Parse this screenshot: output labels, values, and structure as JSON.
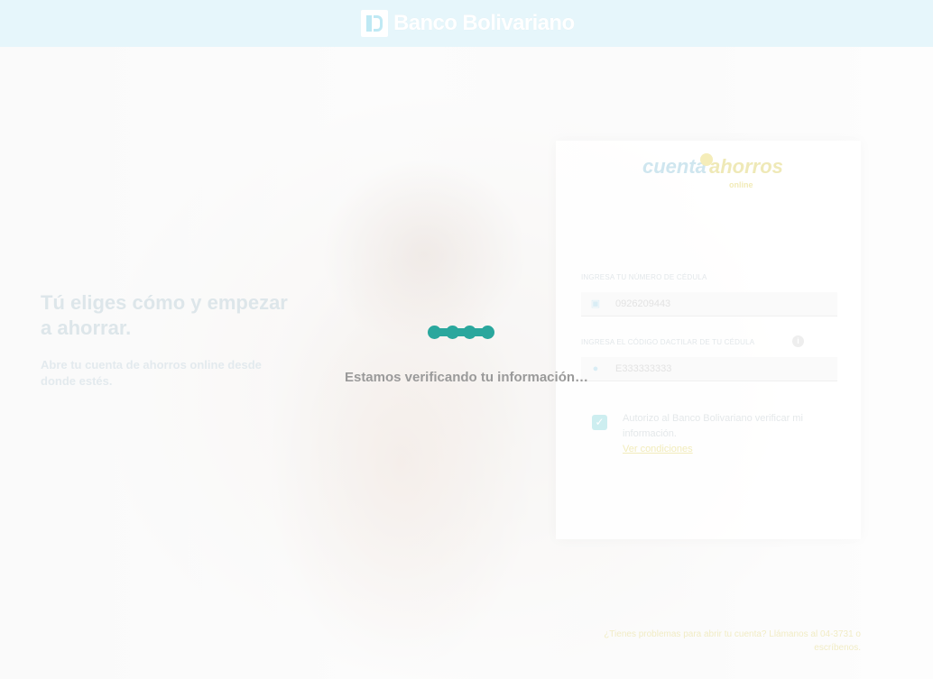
{
  "header": {
    "brand_name": "Banco Bolivariano",
    "logo_icon": "bb-monogram-icon",
    "background": "#e6f6fb"
  },
  "hero": {
    "headline": "Tú eliges cómo y empezar a ahorrar.",
    "subline": "Abre tu cuenta de ahorros online desde donde estés."
  },
  "card": {
    "logo": {
      "part1": "cuenta",
      "part2": "ahorros",
      "tag": "online"
    },
    "id_field": {
      "label": "INGRESA TU NÚMERO DE CÉDULA",
      "value": "0926209443",
      "icon": "id-card-icon"
    },
    "code_field": {
      "label": "INGRESA EL CÓDIGO DACTILAR DE TU CÉDULA",
      "value": "E333333333",
      "icon": "fingerprint-icon"
    },
    "consent": {
      "text": "Autorizo al Banco Bolivariano verificar mi información.",
      "link": "Ver condiciones",
      "checked": true
    }
  },
  "footer": {
    "note": "¿Tienes problemas para abrir tu cuenta? Llámanos al 04-3731 o escríbenos."
  },
  "overlay": {
    "message": "Estamos verificando tu información…",
    "accent": "#2aa79d"
  }
}
